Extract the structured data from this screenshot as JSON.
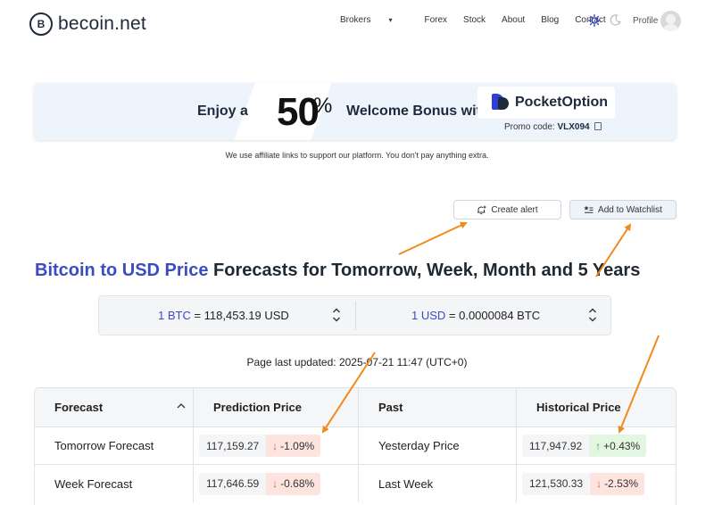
{
  "header": {
    "logo_mark": "B",
    "logo_text": "becoin.net",
    "nav": [
      {
        "label": "Brokers",
        "caret": "▾"
      },
      {
        "label": "Forex"
      },
      {
        "label": "Stock"
      },
      {
        "label": "About"
      },
      {
        "label": "Blog"
      },
      {
        "label": "Contact"
      }
    ],
    "profile_label": "Profile"
  },
  "banner": {
    "enjoy": "Enjoy a",
    "percent_value": "50",
    "percent_sign": "%",
    "welcome": "Welcome Bonus with",
    "partner": "PocketOption",
    "promo_label": "Promo code:",
    "promo_code": "VLX094"
  },
  "affiliate_note": "We use affiliate links to support our platform. You don't pay anything extra.",
  "actions": {
    "create_alert": "Create alert",
    "add_watchlist": "Add to Watchlist"
  },
  "title": {
    "accent": "Bitcoin to USD Price",
    "rest": " Forecasts for Tomorrow, Week, Month and 5 Years"
  },
  "converter": {
    "left_accent": "1 BTC",
    "left_rest": " = 118,453.19 USD",
    "right_accent": "1 USD",
    "right_rest": " = 0.0000084 BTC"
  },
  "updated": "Page last updated: 2025-07-21 11:47 (UTC+0)",
  "table": {
    "headers": [
      "Forecast",
      "Prediction Price",
      "Past",
      "Historical Price"
    ],
    "rows": [
      {
        "forecast": "Tomorrow Forecast",
        "pred_price": "117,159.27",
        "pred_change": "-1.09%",
        "past": "Yesterday Price",
        "hist_price": "117,947.92",
        "hist_change": "+0.43%"
      },
      {
        "forecast": "Week Forecast",
        "pred_price": "117,646.59",
        "pred_change": "-0.68%",
        "past": "Last Week",
        "hist_price": "121,530.33",
        "hist_change": "-2.53%"
      }
    ]
  },
  "colors": {
    "accent": "#3b4bc2",
    "annotation": "#f08a1c",
    "negative_bg": "#fde4df",
    "positive_bg": "#e3f6e1"
  }
}
